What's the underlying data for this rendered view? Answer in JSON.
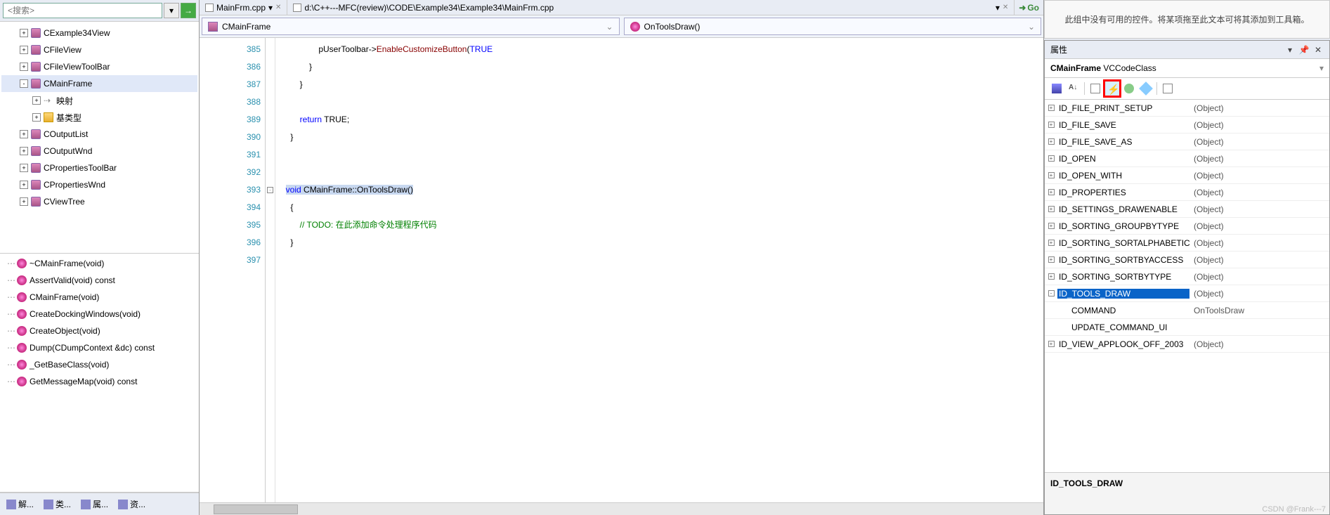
{
  "search": {
    "placeholder": "<搜索>"
  },
  "classTree": [
    {
      "indent": 1,
      "exp": "+",
      "icon": "purple",
      "label": "CExample34View"
    },
    {
      "indent": 1,
      "exp": "+",
      "icon": "purple",
      "label": "CFileView"
    },
    {
      "indent": 1,
      "exp": "+",
      "icon": "purple",
      "label": "CFileViewToolBar"
    },
    {
      "indent": 1,
      "exp": "-",
      "icon": "purple",
      "label": "CMainFrame",
      "sel": true
    },
    {
      "indent": 2,
      "exp": "+",
      "icon": "arrow",
      "label": "映射"
    },
    {
      "indent": 2,
      "exp": "+",
      "icon": "folder",
      "label": "基类型"
    },
    {
      "indent": 1,
      "exp": "+",
      "icon": "purple",
      "label": "COutputList"
    },
    {
      "indent": 1,
      "exp": "+",
      "icon": "purple",
      "label": "COutputWnd"
    },
    {
      "indent": 1,
      "exp": "+",
      "icon": "purple",
      "label": "CPropertiesToolBar"
    },
    {
      "indent": 1,
      "exp": "+",
      "icon": "purple",
      "label": "CPropertiesWnd"
    },
    {
      "indent": 1,
      "exp": "+",
      "icon": "purple",
      "label": "CViewTree"
    }
  ],
  "memberTree": [
    {
      "icon": "pink",
      "label": "~CMainFrame(void)"
    },
    {
      "icon": "pink",
      "label": "AssertValid(void) const"
    },
    {
      "icon": "pink",
      "label": "CMainFrame(void)"
    },
    {
      "icon": "pink",
      "label": "CreateDockingWindows(void)"
    },
    {
      "icon": "pink",
      "label": "CreateObject(void)"
    },
    {
      "icon": "pink",
      "label": "Dump(CDumpContext &dc) const"
    },
    {
      "icon": "pink",
      "label": "_GetBaseClass(void)"
    },
    {
      "icon": "pink",
      "label": "GetMessageMap(void) const"
    }
  ],
  "bottomTabs": [
    {
      "label": "解..."
    },
    {
      "label": "类..."
    },
    {
      "label": "属..."
    },
    {
      "label": "资..."
    }
  ],
  "fileTabs": {
    "tab1": "MainFrm.cpp",
    "tab2": "d:\\C++---MFC(review)\\CODE\\Example34\\Example34\\MainFrm.cpp",
    "go": "Go"
  },
  "scope": {
    "cls": "CMainFrame",
    "fn": "OnToolsDraw()"
  },
  "lines": {
    "start": 385,
    "rows": [
      {
        "n": 385,
        "html": "                pUserToolbar-><span class='mem'>EnableCustomizeButton</span>(<span class='kw'>TRUE</span>"
      },
      {
        "n": 386,
        "html": "            }"
      },
      {
        "n": 387,
        "html": "        }"
      },
      {
        "n": 388,
        "html": ""
      },
      {
        "n": 389,
        "html": "        <span class='kw'>return</span> TRUE;"
      },
      {
        "n": 390,
        "html": "    }"
      },
      {
        "n": 391,
        "html": ""
      },
      {
        "n": 392,
        "html": ""
      },
      {
        "n": 393,
        "html": "  <span class='hl'><span class='kw'>void</span> CMainFrame::OnToolsDraw()</span>",
        "fold": "-"
      },
      {
        "n": 394,
        "html": "    {"
      },
      {
        "n": 395,
        "html": "        <span class='cmt'>// TODO: 在此添加命令处理程序代码</span>"
      },
      {
        "n": 396,
        "html": "    }"
      },
      {
        "n": 397,
        "html": ""
      }
    ]
  },
  "rightTop": "此组中没有可用的控件。将某项拖至此文本可将其添加到工具箱。",
  "propsPanel": {
    "title": "属性",
    "object": "CMainFrame",
    "objectType": "VCCodeClass",
    "rows": [
      {
        "exp": "+",
        "name": "ID_FILE_PRINT_SETUP",
        "val": "(Object)"
      },
      {
        "exp": "+",
        "name": "ID_FILE_SAVE",
        "val": "(Object)"
      },
      {
        "exp": "+",
        "name": "ID_FILE_SAVE_AS",
        "val": "(Object)"
      },
      {
        "exp": "+",
        "name": "ID_OPEN",
        "val": "(Object)"
      },
      {
        "exp": "+",
        "name": "ID_OPEN_WITH",
        "val": "(Object)"
      },
      {
        "exp": "+",
        "name": "ID_PROPERTIES",
        "val": "(Object)"
      },
      {
        "exp": "+",
        "name": "ID_SETTINGS_DRAWENABLE",
        "val": "(Object)"
      },
      {
        "exp": "+",
        "name": "ID_SORTING_GROUPBYTYPE",
        "val": "(Object)"
      },
      {
        "exp": "+",
        "name": "ID_SORTING_SORTALPHABETIC",
        "val": "(Object)"
      },
      {
        "exp": "+",
        "name": "ID_SORTING_SORTBYACCESS",
        "val": "(Object)"
      },
      {
        "exp": "+",
        "name": "ID_SORTING_SORTBYTYPE",
        "val": "(Object)"
      },
      {
        "exp": "-",
        "name": "ID_TOOLS_DRAW",
        "val": "(Object)",
        "sel": true
      },
      {
        "child": true,
        "name": "COMMAND",
        "val": "OnToolsDraw"
      },
      {
        "child": true,
        "name": "UPDATE_COMMAND_UI",
        "val": ""
      },
      {
        "exp": "+",
        "name": "ID_VIEW_APPLOOK_OFF_2003",
        "val": "(Object)"
      }
    ],
    "footer": "ID_TOOLS_DRAW"
  },
  "watermark": "CSDN @Frank---7"
}
